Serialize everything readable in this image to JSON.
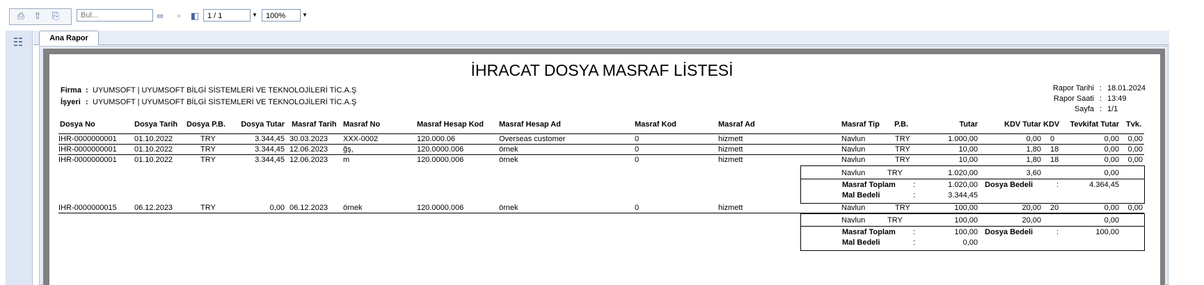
{
  "toolbar": {
    "search_placeholder": "Bul...",
    "page_value": "1 / 1",
    "zoom_value": "100%",
    "icons": [
      "print-icon",
      "export-icon",
      "print-settings-icon",
      "binoculars-icon",
      "page-setup-icon",
      "page-export-icon",
      "dropdown-arrow-icon"
    ]
  },
  "tabs": {
    "main_tab": "Ana Rapor"
  },
  "report": {
    "title": "İHRACAT DOSYA MASRAF LİSTESİ",
    "firma_label": "Firma",
    "firma_value": "UYUMSOFT | UYUMSOFT BİLGİ SİSTEMLERİ VE TEKNOLOJİLERİ TİC.A.Ş",
    "isyeri_label": "İşyeri",
    "isyeri_value": "UYUMSOFT | UYUMSOFT BİLGİ SİSTEMLERİ VE TEKNOLOJİLERİ TİC.A.Ş",
    "colon": ":",
    "rapor_tarihi_label": "Rapor Tarihi",
    "rapor_tarihi_value": "18.01.2024",
    "rapor_saati_label": "Rapor Saati",
    "rapor_saati_value": "13:49",
    "sayfa_label": "Sayfa",
    "sayfa_value": "1/1",
    "columns": [
      "Dosya No",
      "Dosya Tarih",
      "Dosya P.B.",
      "Dosya Tutar",
      "Masraf Tarih",
      "Masraf No",
      "Masraf Hesap Kod",
      "Masraf Hesap Ad",
      "Masraf Kod",
      "Masraf Ad",
      "Masraf Tip",
      "P.B.",
      "Tutar",
      "KDV Tutar",
      "KDV",
      "Tevkifat Tutar",
      "Tvk."
    ],
    "group1_rows": [
      [
        "IHR-0000000001",
        "01.10.2022",
        "TRY",
        "3.344,45",
        "30.03.2023",
        "XXX-0002",
        "120.000.06",
        "Overseas customer",
        "0",
        "hizmett",
        "Navlun",
        "TRY",
        "1.000,00",
        "0,00",
        "0",
        "0,00",
        "0,00"
      ],
      [
        "IHR-0000000001",
        "01.10.2022",
        "TRY",
        "3.344,45",
        "12.06.2023",
        "ğş,",
        "120.0000.006",
        "örnek",
        "0",
        "hizmett",
        "Navlun",
        "TRY",
        "10,00",
        "1,80",
        "18",
        "0,00",
        "0,00"
      ],
      [
        "IHR-0000000001",
        "01.10.2022",
        "TRY",
        "3.344,45",
        "12.06.2023",
        "m",
        "120.0000.006",
        "örnek",
        "0",
        "hizmett",
        "Navlun",
        "TRY",
        "10,00",
        "1,80",
        "18",
        "0,00",
        "0,00"
      ]
    ],
    "group1_summary": {
      "tip": "Navlun",
      "pb": "TRY",
      "tutar": "1.020,00",
      "kdv_tutar": "3,60",
      "tevkifat": "0,00",
      "masraf_toplam_label": "Masraf Toplam",
      "masraf_toplam": "1.020,00",
      "dosya_bedeli_label": "Dosya Bedeli",
      "dosya_bedeli": "4.364,45",
      "mal_bedeli_label": "Mal Bedeli",
      "mal_bedeli": "3.344,45"
    },
    "group2_rows": [
      [
        "IHR-0000000015",
        "06.12.2023",
        "TRY",
        "0,00",
        "06.12.2023",
        "örnek",
        "120.0000.006",
        "örnek",
        "0",
        "hizmett",
        "Navlun",
        "TRY",
        "100,00",
        "20,00",
        "20",
        "0,00",
        "0,00"
      ]
    ],
    "group2_summary": {
      "tip": "Navlun",
      "pb": "TRY",
      "tutar": "100,00",
      "kdv_tutar": "20,00",
      "tevkifat": "0,00",
      "masraf_toplam_label": "Masraf Toplam",
      "masraf_toplam": "100,00",
      "dosya_bedeli_label": "Dosya Bedeli",
      "dosya_bedeli": "100,00",
      "mal_bedeli_label": "Mal Bedeli",
      "mal_bedeli": "0,00"
    }
  }
}
